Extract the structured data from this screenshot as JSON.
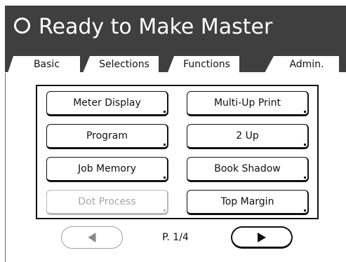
{
  "header": {
    "status_icon": "status-circle-icon",
    "status_text": "Ready to Make Master"
  },
  "tabs": [
    {
      "label": "Basic",
      "active": false
    },
    {
      "label": "Selections",
      "active": false
    },
    {
      "label": "Functions",
      "active": true
    },
    {
      "label": "Admin.",
      "active": false
    }
  ],
  "functions": {
    "buttons": [
      {
        "label": "Meter Display",
        "enabled": true
      },
      {
        "label": "Multi-Up Print",
        "enabled": true
      },
      {
        "label": "Program",
        "enabled": true
      },
      {
        "label": "2 Up",
        "enabled": true
      },
      {
        "label": "Job Memory",
        "enabled": true
      },
      {
        "label": "Book Shadow",
        "enabled": true
      },
      {
        "label": "Dot Process",
        "enabled": false
      },
      {
        "label": "Top Margin",
        "enabled": true
      }
    ]
  },
  "pagination": {
    "indicator": "P. 1/4",
    "prev_icon": "left-triangle-icon",
    "next_icon": "right-triangle-icon",
    "prev_enabled": false,
    "next_enabled": true
  },
  "colors": {
    "header_background": "#3f3f3f",
    "header_text": "#ffffff",
    "disabled_text": "#a8a8a8"
  }
}
